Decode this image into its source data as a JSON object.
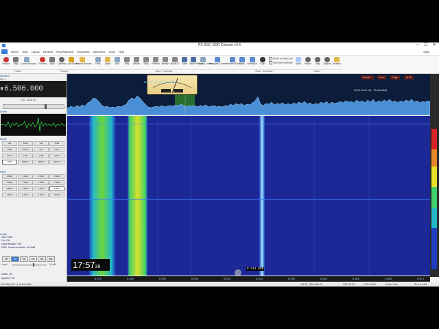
{
  "window": {
    "title": "RX 666 | SDR Console v3.4",
    "controls": [
      "—",
      "☐",
      "✕"
    ]
  },
  "menu": {
    "items": [
      "Home",
      "View",
      "Layout",
      "Receive",
      "Rec/Playback",
      "Favourites",
      "Memories",
      "Tools",
      "Help"
    ],
    "style": "Style"
  },
  "ribbon": {
    "buttons": [
      "Record",
      "Stop",
      "Cache Browse",
      "Record",
      "Stop",
      "Options",
      "Lock Radio",
      "Power Browse",
      "Files",
      "Open",
      "Add",
      "Play",
      "Pause",
      "Stop",
      "Rewind",
      "Restart",
      "Back 10",
      "Save",
      "Save Passes",
      "Guard Center",
      "Navigate Center",
      "Parallel Editor",
      "Data",
      "Schedule",
      "Start",
      "Input",
      "Pause",
      "Stop",
      "Options",
      "Browse"
    ],
    "groups": [
      "Radio",
      "Record",
      "Data - Playback",
      "Data - Schedule",
      "Video"
    ],
    "checks": [
      "Show in status bar",
      "Start automatically"
    ]
  },
  "receive": {
    "section": "Receive",
    "vfo": "RX 1",
    "frequency": "6.506.000",
    "freq_range": "100 - 3100 Hz",
    "audio_label": "Audio",
    "mode_label": "Mode",
    "modes": [
      "AM",
      "SAM",
      "AM",
      "DSB",
      "NFM",
      "SAM-S",
      "CW",
      "CW-L",
      "CW-U",
      "LSB",
      "USB",
      "WFM",
      "USB",
      "DRM-1",
      "DRM-2",
      "DRM-3"
    ],
    "filter_label": "Filter",
    "filters": [
      "1.8kHz",
      "2.4kHz",
      "2.7kHz",
      "3.0kHz",
      "3.3kHz",
      "3.6kHz",
      "4.0kHz",
      "4.5kHz",
      "5.0kHz",
      "5.5kHz",
      "6.0kHz",
      "6.5kHz",
      "7.0kHz",
      "8.0kHz",
      "9.0kHz",
      "10kHz"
    ],
    "agc_section": "Audio",
    "agc_title": "AGC Slow",
    "ctrl_off": "Ctrl: Off",
    "noise_blanker": "Noise Blanker: Off",
    "dnr": "DNR: Spectrum Model: Vol 6dB",
    "agc_buttons": [
      "Off",
      "M1",
      "M2",
      "M3",
      "M4",
      "M5"
    ],
    "level_label": "Level",
    "level_value": "16 dB",
    "notch": "Notch: Off",
    "squelch": "Squelch: Off"
  },
  "spectrum": {
    "station_label": "Marine Weather Broadcast",
    "right_label": "HCIS VAR HK - THAILAND",
    "scale_buttons": [
      "Scale...",
      "Low",
      "High",
      "▲▼"
    ]
  },
  "waterfall": {
    "time": "17:57",
    "seconds": "39",
    "cursor_freq": "6.514.050",
    "axis_ticks": [
      "6.470",
      "6.480",
      "6.490",
      "6.500",
      "6.510",
      "6.520",
      "6.530",
      "6.540",
      "6.550",
      "6.560",
      "6.570"
    ]
  },
  "status": {
    "left": "RX 666 | RX 1 | 10.000 MHz",
    "right_items": [
      "-69.52, 2054 WB-15",
      "CPU 21.0%",
      "GPU 40.6%",
      "Audio: Fine",
      "Size 4.8 GB"
    ]
  }
}
